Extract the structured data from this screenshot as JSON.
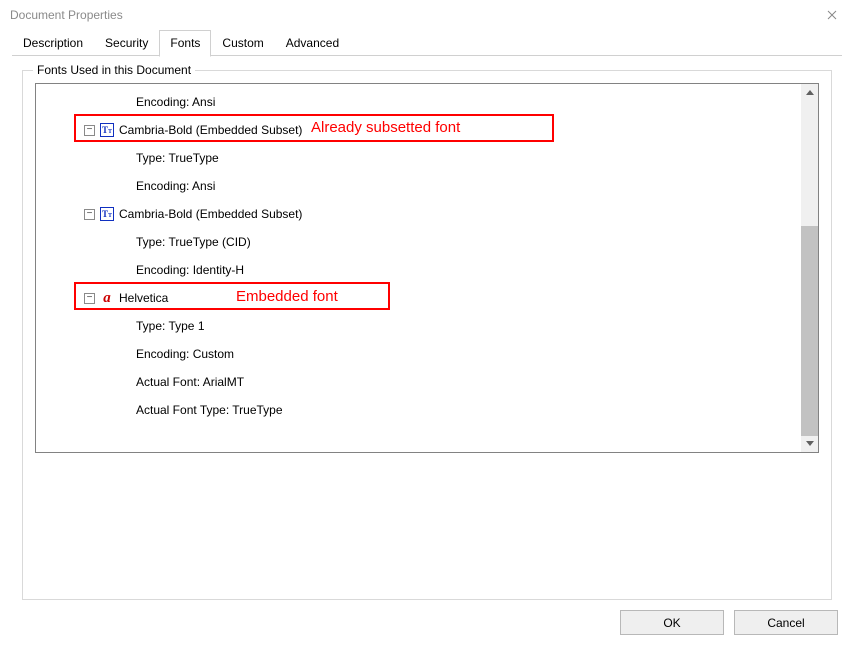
{
  "window": {
    "title": "Document Properties"
  },
  "tabs": {
    "items": [
      {
        "label": "Description"
      },
      {
        "label": "Security"
      },
      {
        "label": "Fonts",
        "active": true
      },
      {
        "label": "Custom"
      },
      {
        "label": "Advanced"
      }
    ]
  },
  "group": {
    "label": "Fonts Used in this Document"
  },
  "fonts": [
    {
      "name": "Cambria-Bold (Embedded Subset)",
      "icon": "ttf",
      "partial_above": true,
      "children": [
        {
          "label": "Encoding: Ansi"
        }
      ]
    },
    {
      "name": "Cambria-Bold (Embedded Subset)",
      "icon": "ttf",
      "children": [
        {
          "label": "Type: TrueType"
        },
        {
          "label": "Encoding: Ansi"
        }
      ]
    },
    {
      "name": "Cambria-Bold (Embedded Subset)",
      "icon": "ttf",
      "children": [
        {
          "label": "Type: TrueType (CID)"
        },
        {
          "label": "Encoding: Identity-H"
        }
      ]
    },
    {
      "name": "Helvetica",
      "icon": "ps",
      "children": [
        {
          "label": "Type: Type 1"
        },
        {
          "label": "Encoding: Custom"
        },
        {
          "label": "Actual Font: ArialMT"
        },
        {
          "label": "Actual Font Type: TrueType"
        }
      ]
    }
  ],
  "annotations": {
    "subset": "Already subsetted font",
    "embedded": "Embedded font"
  },
  "buttons": {
    "ok": "OK",
    "cancel": "Cancel"
  },
  "icon_glyphs": {
    "ttf_upper": "T",
    "ttf_lower": "T",
    "ps": "a"
  }
}
